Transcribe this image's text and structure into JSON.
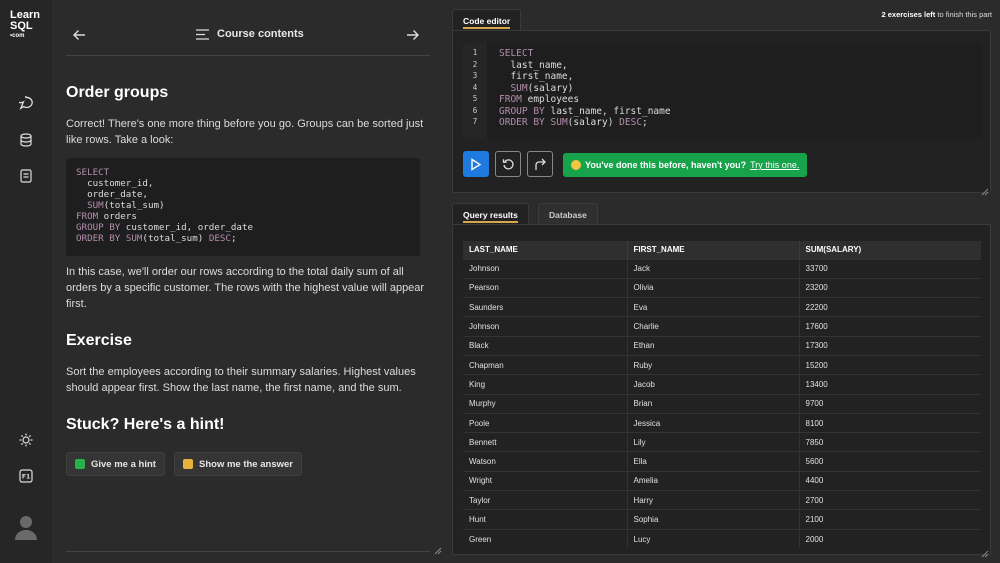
{
  "app": {
    "logo_line1": "Learn",
    "logo_line2": "SQL",
    "logo_line3": "•com"
  },
  "rail": {
    "icons": [
      "chat-icon",
      "database-icon",
      "notes-icon",
      "sun-icon",
      "shortcut-f1-icon",
      "user-avatar"
    ]
  },
  "lesson_nav": {
    "title": "Course contents"
  },
  "lesson": {
    "heading": "Order groups",
    "intro": "Correct! There's one more thing before you go. Groups can be sorted just like rows. Take a look:",
    "code": "SELECT\n  customer_id,\n  order_date,\n  SUM(total_sum)\nFROM orders\nGROUP BY customer_id, order_date\nORDER BY SUM(total_sum) DESC;",
    "explanation": "In this case, we'll order our rows according to the total daily sum of all orders by a specific customer. The rows with the highest value will appear first.",
    "exercise_heading": "Exercise",
    "exercise_text": "Sort the employees according to their summary salaries. Highest values should appear first. Show the last name, the first name, and the sum.",
    "hint_heading": "Stuck? Here's a hint!",
    "hint_button": "Give me a hint",
    "answer_button": "Show me the answer"
  },
  "exercises_left": {
    "count": "2 exercises left",
    "suffix": "to finish this part"
  },
  "editor": {
    "tab_label": "Code editor",
    "line_numbers": [
      "1",
      "2",
      "3",
      "4",
      "5",
      "6",
      "7"
    ],
    "code_lines": [
      "SELECT",
      "  last_name,",
      "  first_name,",
      "  SUM(salary)",
      "FROM employees",
      "GROUP BY last_name, first_name",
      "ORDER BY SUM(salary) DESC;"
    ],
    "success_message_bold": "You've done this before, haven't you?",
    "success_message_link": "Try this one."
  },
  "results": {
    "tab_results": "Query results",
    "tab_database": "Database",
    "columns": [
      "LAST_NAME",
      "FIRST_NAME",
      "SUM(SALARY)"
    ],
    "rows": [
      [
        "Johnson",
        "Jack",
        "33700"
      ],
      [
        "Pearson",
        "Olivia",
        "23200"
      ],
      [
        "Saunders",
        "Eva",
        "22200"
      ],
      [
        "Johnson",
        "Charlie",
        "17600"
      ],
      [
        "Black",
        "Ethan",
        "17300"
      ],
      [
        "Chapman",
        "Ruby",
        "15200"
      ],
      [
        "King",
        "Jacob",
        "13400"
      ],
      [
        "Murphy",
        "Brian",
        "9700"
      ],
      [
        "Poole",
        "Jessica",
        "8100"
      ],
      [
        "Bennett",
        "Lily",
        "7850"
      ],
      [
        "Watson",
        "Ella",
        "5600"
      ],
      [
        "Wright",
        "Amelia",
        "4400"
      ],
      [
        "Taylor",
        "Harry",
        "2700"
      ],
      [
        "Hunt",
        "Sophia",
        "2100"
      ],
      [
        "Green",
        "Lucy",
        "2000"
      ]
    ]
  },
  "colors": {
    "run_button": "#1f7ae0",
    "success": "#17a34a",
    "active_tab_underline": "#d4a84a"
  }
}
